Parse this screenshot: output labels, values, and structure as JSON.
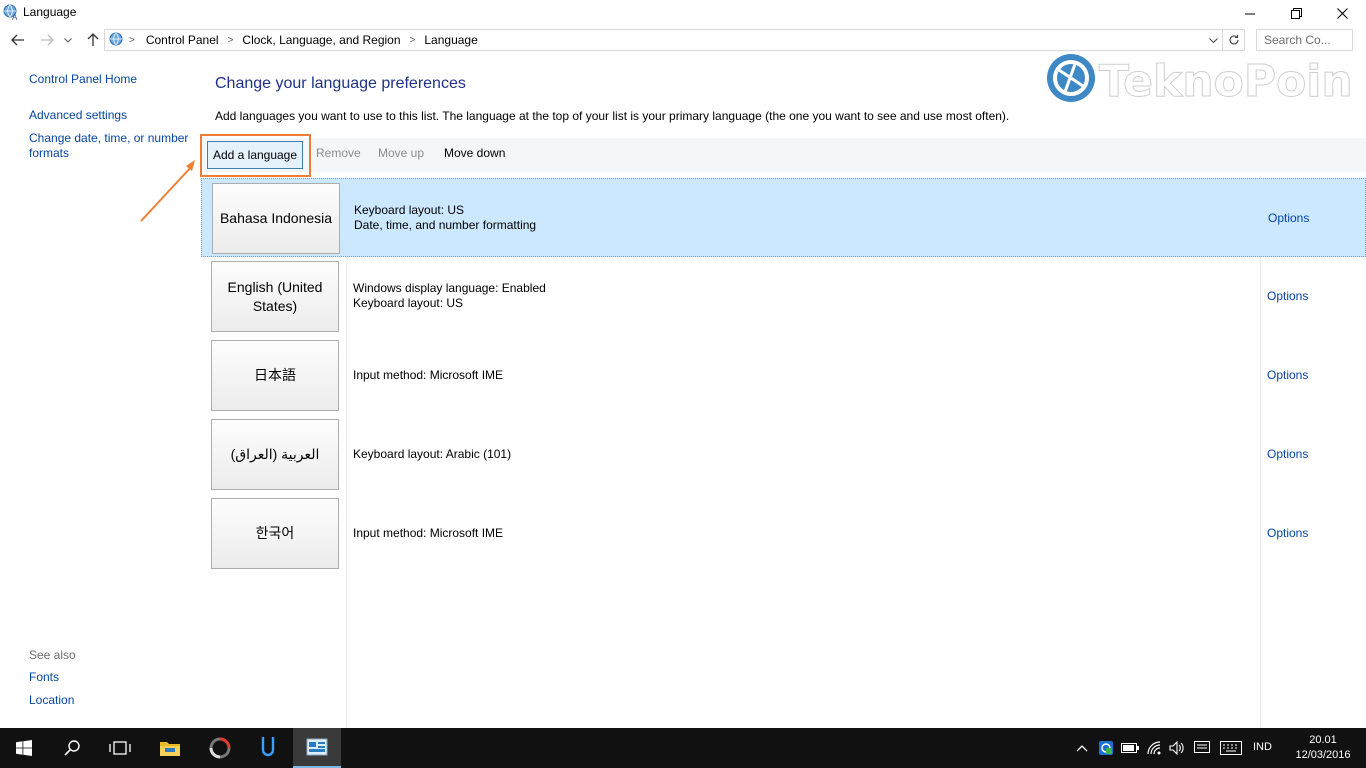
{
  "window": {
    "title": "Language"
  },
  "address": {
    "crumbs": [
      "Control Panel",
      "Clock, Language, and Region",
      "Language"
    ],
    "search_placeholder": "Search Co..."
  },
  "sidebar": {
    "home": "Control Panel Home",
    "advanced": "Advanced settings",
    "change_date": "Change date, time, or number formats",
    "see_also": "See also",
    "fonts": "Fonts",
    "location": "Location"
  },
  "main": {
    "title": "Change your language preferences",
    "description": "Add languages you want to use to this list. The language at the top of your list is your primary language (the one you want to see and use most often).",
    "toolbar": {
      "add": "Add a language",
      "remove": "Remove",
      "move_up": "Move up",
      "move_down": "Move down"
    },
    "languages": [
      {
        "name": "Bahasa Indonesia",
        "line1": "Keyboard layout: US",
        "line2": "Date, time, and number formatting",
        "options": "Options"
      },
      {
        "name": "English (United States)",
        "line1": "Windows display language: Enabled",
        "line2": "Keyboard layout: US",
        "options": "Options"
      },
      {
        "name": "日本語",
        "line1": "Input method: Microsoft IME",
        "line2": "",
        "options": "Options"
      },
      {
        "name": "العربية (العراق)",
        "line1": "Keyboard layout: Arabic (101)",
        "line2": "",
        "options": "Options"
      },
      {
        "name": "한국어",
        "line1": "Input method: Microsoft IME",
        "line2": "",
        "options": "Options"
      }
    ]
  },
  "watermark": {
    "text": "TeknoPoin"
  },
  "taskbar": {
    "input_indicator": "IND",
    "time": "20.01",
    "date": "12/03/2016"
  },
  "colors": {
    "accent": "#ef7e33",
    "link": "#0645a2",
    "title": "#1e3287",
    "selected_row": "#cce8ff"
  }
}
